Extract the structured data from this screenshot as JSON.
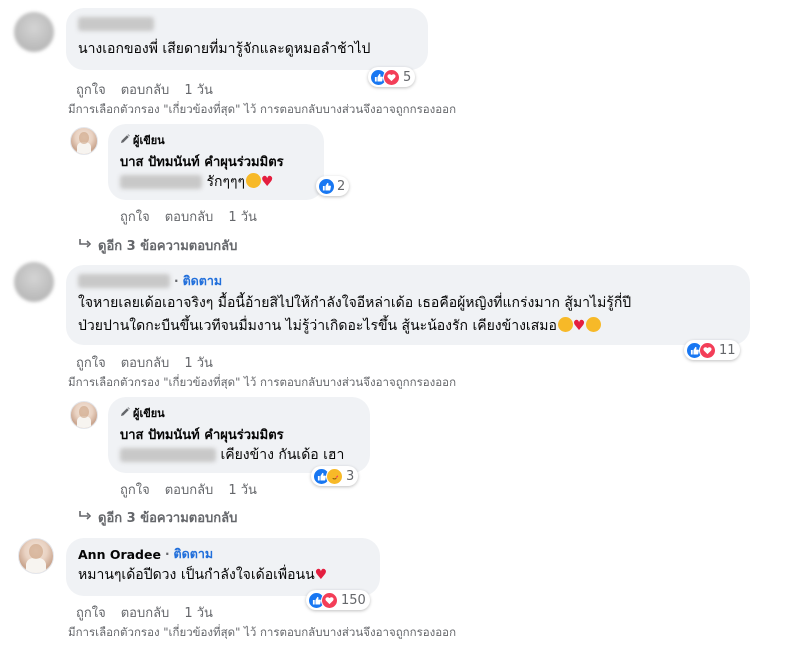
{
  "comments": [
    {
      "text": "นางเอกของพี่ เสียดายที่มารู้จักและดูหมอลำช้าไป",
      "like_label": "ถูกใจ",
      "reply_label": "ตอบกลับ",
      "time": "1 วัน",
      "reaction_count": "5",
      "filter_note": "มีการเลือกตัวกรอง \"เกี่ยวข้องที่สุด\" ไว้ การตอบกลับบางส่วนจึงอาจถูกกรองออก",
      "reply": {
        "author_tag": "ผู้เขียน",
        "author_name": "บาส ปัทมนันท์ คำผุนร่วมมิตร",
        "text": "รักๆๆๆ",
        "like_label": "ถูกใจ",
        "reply_label": "ตอบกลับ",
        "time": "1 วัน",
        "reaction_count": "2"
      },
      "more_replies": "ดูอีก 3 ข้อความตอบกลับ"
    },
    {
      "follow_label": "ติดตาม",
      "text_line1": "ใจหายเลยเด้อเอาจริงๆ มื้อนี้อ้ายสิไปให้กำลังใจอีหล่าเด้อ เธอคือผู้หญิงที่แกร่งมาก สู้มาไม่รู้กี่ปี",
      "text_line2": "ป่วยปานใดกะบืนขึ้นเวทีจนมื่มงาน ไม่รู้ว่าเกิดอะไรขึ้น สู้นะน้องรัก เคียงข้างเสมอ",
      "like_label": "ถูกใจ",
      "reply_label": "ตอบกลับ",
      "time": "1 วัน",
      "reaction_count": "11",
      "filter_note": "มีการเลือกตัวกรอง \"เกี่ยวข้องที่สุด\" ไว้ การตอบกลับบางส่วนจึงอาจถูกกรองออก",
      "reply": {
        "author_tag": "ผู้เขียน",
        "author_name": "บาส ปัทมนันท์ คำผุนร่วมมิตร",
        "text": "เคียงข้าง กันเด้อ เฮา",
        "like_label": "ถูกใจ",
        "reply_label": "ตอบกลับ",
        "time": "1 วัน",
        "reaction_count": "3"
      },
      "more_replies": "ดูอีก 3 ข้อความตอบกลับ"
    },
    {
      "author_name": "Ann Oradee",
      "follow_label": "ติดตาม",
      "text": "หมานๆเด้อปีดวง เป็นกำลังใจเด้อเพื่อนน",
      "like_label": "ถูกใจ",
      "reply_label": "ตอบกลับ",
      "time": "1 วัน",
      "reaction_count": "150",
      "filter_note": "มีการเลือกตัวกรอง \"เกี่ยวข้องที่สุด\" ไว้ การตอบกลับบางส่วนจึงอาจถูกกรองออก"
    }
  ],
  "colors": {
    "bubble": "#f0f2f5",
    "link_blue": "#216fdb",
    "like_blue": "#1877f2",
    "love_red": "#f33e58",
    "muted": "#65676b"
  }
}
